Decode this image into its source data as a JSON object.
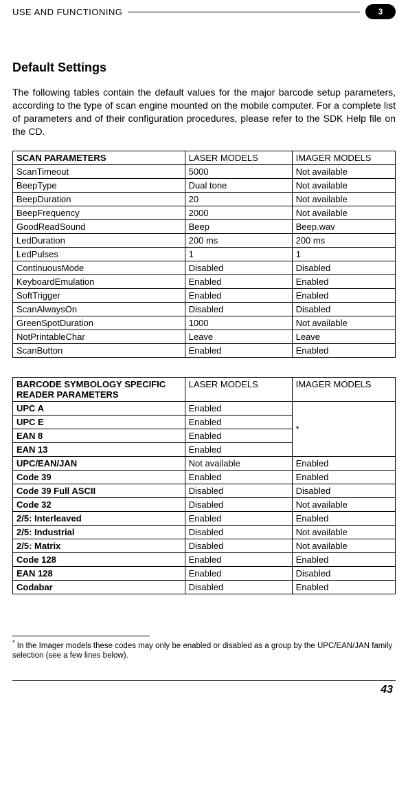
{
  "header": {
    "running_title": "USE AND FUNCTIONING",
    "chapter_number": "3"
  },
  "section_title": "Default Settings",
  "intro_paragraph": "The following tables contain the default values for the major barcode setup parameters, according to the type of scan engine mounted on the mobile computer. For a complete list of parameters and of their configuration procedures, please refer to the SDK Help file on the CD.",
  "table_scan": {
    "headers": {
      "param": "SCAN PARAMETERS",
      "laser": "LASER MODELS",
      "imager": "IMAGER MODELS"
    },
    "rows": [
      {
        "param": "ScanTimeout",
        "laser": "5000",
        "imager": "Not available"
      },
      {
        "param": "BeepType",
        "laser": "Dual tone",
        "imager": "Not available"
      },
      {
        "param": "BeepDuration",
        "laser": "20",
        "imager": "Not available"
      },
      {
        "param": "BeepFrequency",
        "laser": "2000",
        "imager": "Not available"
      },
      {
        "param": "GoodReadSound",
        "laser": "Beep",
        "imager": "Beep.wav"
      },
      {
        "param": "LedDuration",
        "laser": "200 ms",
        "imager": "200 ms"
      },
      {
        "param": "LedPulses",
        "laser": "1",
        "imager": "1"
      },
      {
        "param": "ContinuousMode",
        "laser": "Disabled",
        "imager": "Disabled"
      },
      {
        "param": "KeyboardEmulation",
        "laser": "Enabled",
        "imager": "Enabled"
      },
      {
        "param": "SoftTrigger",
        "laser": "Enabled",
        "imager": "Enabled"
      },
      {
        "param": "ScanAlwaysOn",
        "laser": "Disabled",
        "imager": "Disabled"
      },
      {
        "param": "GreenSpotDuration",
        "laser": "1000",
        "imager": "Not available"
      },
      {
        "param": "NotPrintableChar",
        "laser": "Leave",
        "imager": "Leave"
      },
      {
        "param": "ScanButton",
        "laser": "Enabled",
        "imager": "Enabled"
      }
    ]
  },
  "table_symbology": {
    "headers": {
      "param": "BARCODE SYMBOLOGY SPECIFIC READER PARAMETERS",
      "laser": "LASER MODELS",
      "imager": "IMAGER MODELS"
    },
    "merged_note_marker": "*",
    "group_rows": [
      {
        "param": "UPC A",
        "laser": "Enabled"
      },
      {
        "param": "UPC E",
        "laser": "Enabled"
      },
      {
        "param": "EAN 8",
        "laser": "Enabled"
      },
      {
        "param": "EAN 13",
        "laser": "Enabled"
      }
    ],
    "rows": [
      {
        "param": "UPC/EAN/JAN",
        "laser": "Not available",
        "imager": "Enabled"
      },
      {
        "param": "Code 39",
        "laser": "Enabled",
        "imager": "Enabled"
      },
      {
        "param": "Code 39 Full ASCII",
        "laser": "Disabled",
        "imager": "Disabled"
      },
      {
        "param": "Code 32",
        "laser": "Disabled",
        "imager": "Not available"
      },
      {
        "param": "2/5: Interleaved",
        "laser": "Enabled",
        "imager": "Enabled"
      },
      {
        "param": "2/5: Industrial",
        "laser": "Disabled",
        "imager": "Not available"
      },
      {
        "param": "2/5: Matrix",
        "laser": "Disabled",
        "imager": "Not available"
      },
      {
        "param": "Code 128",
        "laser": "Enabled",
        "imager": "Enabled"
      },
      {
        "param": "EAN 128",
        "laser": "Enabled",
        "imager": "Disabled"
      },
      {
        "param": "Codabar",
        "laser": "Disabled",
        "imager": "Enabled"
      }
    ]
  },
  "footnote": {
    "marker": "*",
    "text": " In the Imager models these codes may only be enabled or disabled as a group by the UPC/EAN/JAN family selection (see a few lines below)."
  },
  "page_number": "43"
}
